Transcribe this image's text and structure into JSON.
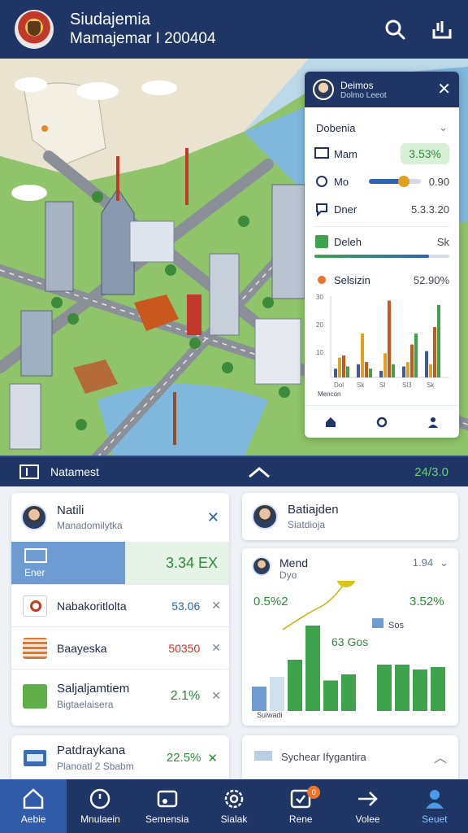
{
  "header": {
    "title": "Siudajemia",
    "subtitle": "Mamajemar I 200404",
    "icons": [
      "search-icon",
      "share-icon"
    ]
  },
  "map_panel": {
    "title": "Deimos",
    "subtitle": "Dolmo Leeot",
    "section": "Dobenia",
    "rows": [
      {
        "label": "Mam",
        "value": "3.53%",
        "icon": "screen-icon"
      },
      {
        "label": "Mo",
        "value": "0.90",
        "icon": "gear-icon",
        "slider": 0.7
      },
      {
        "label": "Dner",
        "value": "5.3.3.20",
        "icon": "chat-icon"
      },
      {
        "label": "Deleh",
        "value": "Sk",
        "icon": "green-square-icon"
      },
      {
        "label": "Selsizin",
        "value": "52.90%",
        "icon": "sun-icon"
      }
    ],
    "chart_xlabel": "Mencon",
    "chart_yticks": [
      "10",
      "20",
      "30"
    ],
    "chart_xticks": [
      "Dol",
      "Sk",
      "Sl",
      "Sl3",
      "Sk"
    ],
    "chart_series_colors": [
      "#3b5ba8",
      "#e0a020",
      "#c8581e",
      "#3fa34d"
    ]
  },
  "statusbar": {
    "label": "Natamest",
    "value": "24/3.0"
  },
  "card_left": {
    "name": "Natili",
    "subtitle": "Manadomilytka",
    "rows": [
      {
        "label": "Ener",
        "value": "3.34 EX",
        "color": "#2e8b3a",
        "selected": true
      },
      {
        "label": "Nabakoritlolta",
        "value": "53.06",
        "color": "#2f64b5"
      },
      {
        "label": "Baayeska",
        "value": "50350",
        "color": "#c8361e"
      },
      {
        "label": "Saljaljamtiem",
        "sub": "Bigtaelaisera",
        "value": "2.1%",
        "color": "#2e8b3a"
      }
    ]
  },
  "card_right_top": {
    "name": "Batiajden",
    "subtitle": "Siatdioja"
  },
  "card_chart": {
    "name": "Mend",
    "subtitle": "Dyo",
    "corner_value": "1.94",
    "label_left": "0.5%2",
    "label_right": "3.52%",
    "label_mid": "63 Gos",
    "label_legend": "Sos",
    "footer": "Suiwadi",
    "chart_data": {
      "type": "bar",
      "series": [
        {
          "values": [
            20,
            28,
            42,
            70,
            25,
            30,
            0,
            38,
            38,
            34,
            36
          ],
          "colors": [
            "#6f9bd3",
            "#cfe0ee",
            "#3fa34d",
            "#3fa34d",
            "#3fa34d",
            "#3fa34d",
            "#ffffff",
            "#3fa34d",
            "#3fa34d",
            "#3fa34d",
            "#3fa34d"
          ]
        }
      ],
      "trend_line": true
    }
  },
  "card_bottom_left": {
    "name": "Patdraykana",
    "subtitle": "Planoatl 2 Sbabm",
    "value": "22.5%"
  },
  "card_bottom_right": {
    "name": "Sychear Ifygantira"
  },
  "bottom_nav": [
    {
      "label": "Aebie",
      "icon": "home-icon",
      "active": true
    },
    {
      "label": "Mnulaein",
      "icon": "clock-icon"
    },
    {
      "label": "Semensia",
      "icon": "music-icon"
    },
    {
      "label": "Sialak",
      "icon": "gear-icon"
    },
    {
      "label": "Rene",
      "icon": "alert-icon",
      "badge": "0"
    },
    {
      "label": "Volee",
      "icon": "arrow-icon"
    },
    {
      "label": "Seuet",
      "icon": "user-icon"
    }
  ]
}
